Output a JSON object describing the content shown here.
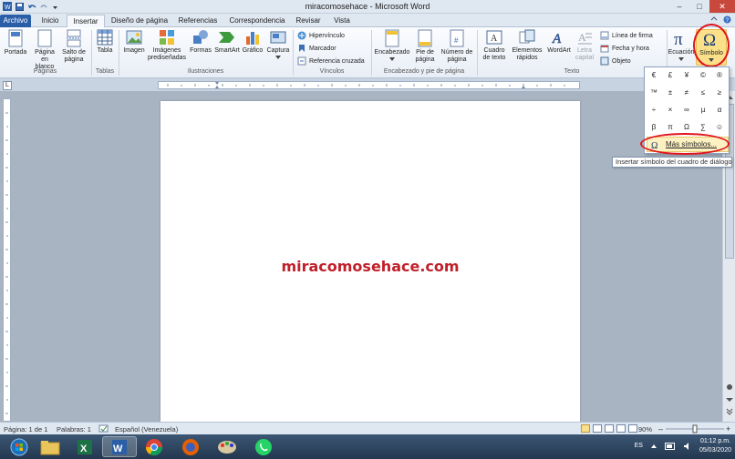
{
  "window": {
    "title": "miracomosehace - Microsoft Word",
    "minimize": "–",
    "maximize": "□",
    "close": "✕"
  },
  "tabs": [
    "Archivo",
    "Inicio",
    "Insertar",
    "Diseño de página",
    "Referencias",
    "Correspondencia",
    "Revisar",
    "Vista"
  ],
  "active_tab": "Insertar",
  "ribbon": {
    "paginas": {
      "label": "Páginas",
      "portada": "Portada",
      "pagina_blanco_1": "Página",
      "pagina_blanco_2": "en blanco",
      "salto_1": "Salto de",
      "salto_2": "página"
    },
    "tablas": {
      "label": "Tablas",
      "tabla": "Tabla"
    },
    "ilustraciones": {
      "label": "Ilustraciones",
      "imagen": "Imagen",
      "imagenes_1": "Imágenes",
      "imagenes_2": "prediseñadas",
      "formas": "Formas",
      "smartart": "SmartArt",
      "grafico": "Gráfico",
      "captura": "Captura"
    },
    "vinculos": {
      "label": "Vínculos",
      "hipervinculo": "Hipervínculo",
      "marcador": "Marcador",
      "referencia": "Referencia cruzada"
    },
    "encabezado": {
      "label": "Encabezado y pie de página",
      "encabezado": "Encabezado",
      "pie_1": "Pie de",
      "pie_2": "página",
      "numero_1": "Número de",
      "numero_2": "página"
    },
    "texto": {
      "label": "Texto",
      "cuadro_1": "Cuadro",
      "cuadro_2": "de texto",
      "elementos_1": "Elementos",
      "elementos_2": "rápidos",
      "wordart": "WordArt",
      "letra_1": "Letra",
      "letra_2": "capital",
      "linea_firma": "Línea de firma",
      "fecha_hora": "Fecha y hora",
      "objeto": "Objeto"
    },
    "simbolos": {
      "ecuacion": "Ecuación",
      "simbolo": "Símbolo"
    }
  },
  "symbol_dropdown": {
    "symbols": [
      "€",
      "£",
      "¥",
      "©",
      "®",
      "™",
      "±",
      "≠",
      "≤",
      "≥",
      "÷",
      "×",
      "∞",
      "µ",
      "α",
      "β",
      "π",
      "Ω",
      "∑",
      "☺"
    ],
    "more": "Más símbolos...",
    "tooltip": "Insertar símbolo del cuadro de diálogo"
  },
  "document": {
    "watermark": "miracomosehace.com"
  },
  "status": {
    "page": "Página: 1 de 1",
    "words": "Palabras: 1",
    "language": "Español (Venezuela)",
    "zoom": "90%"
  },
  "tray": {
    "lang": "ES",
    "time": "01:12 p.m.",
    "date": "05/03/2020"
  },
  "colors": {
    "file_tab": "#2a5fa8",
    "watermark": "#c0202a",
    "highlight_ring": "#e0141c"
  }
}
